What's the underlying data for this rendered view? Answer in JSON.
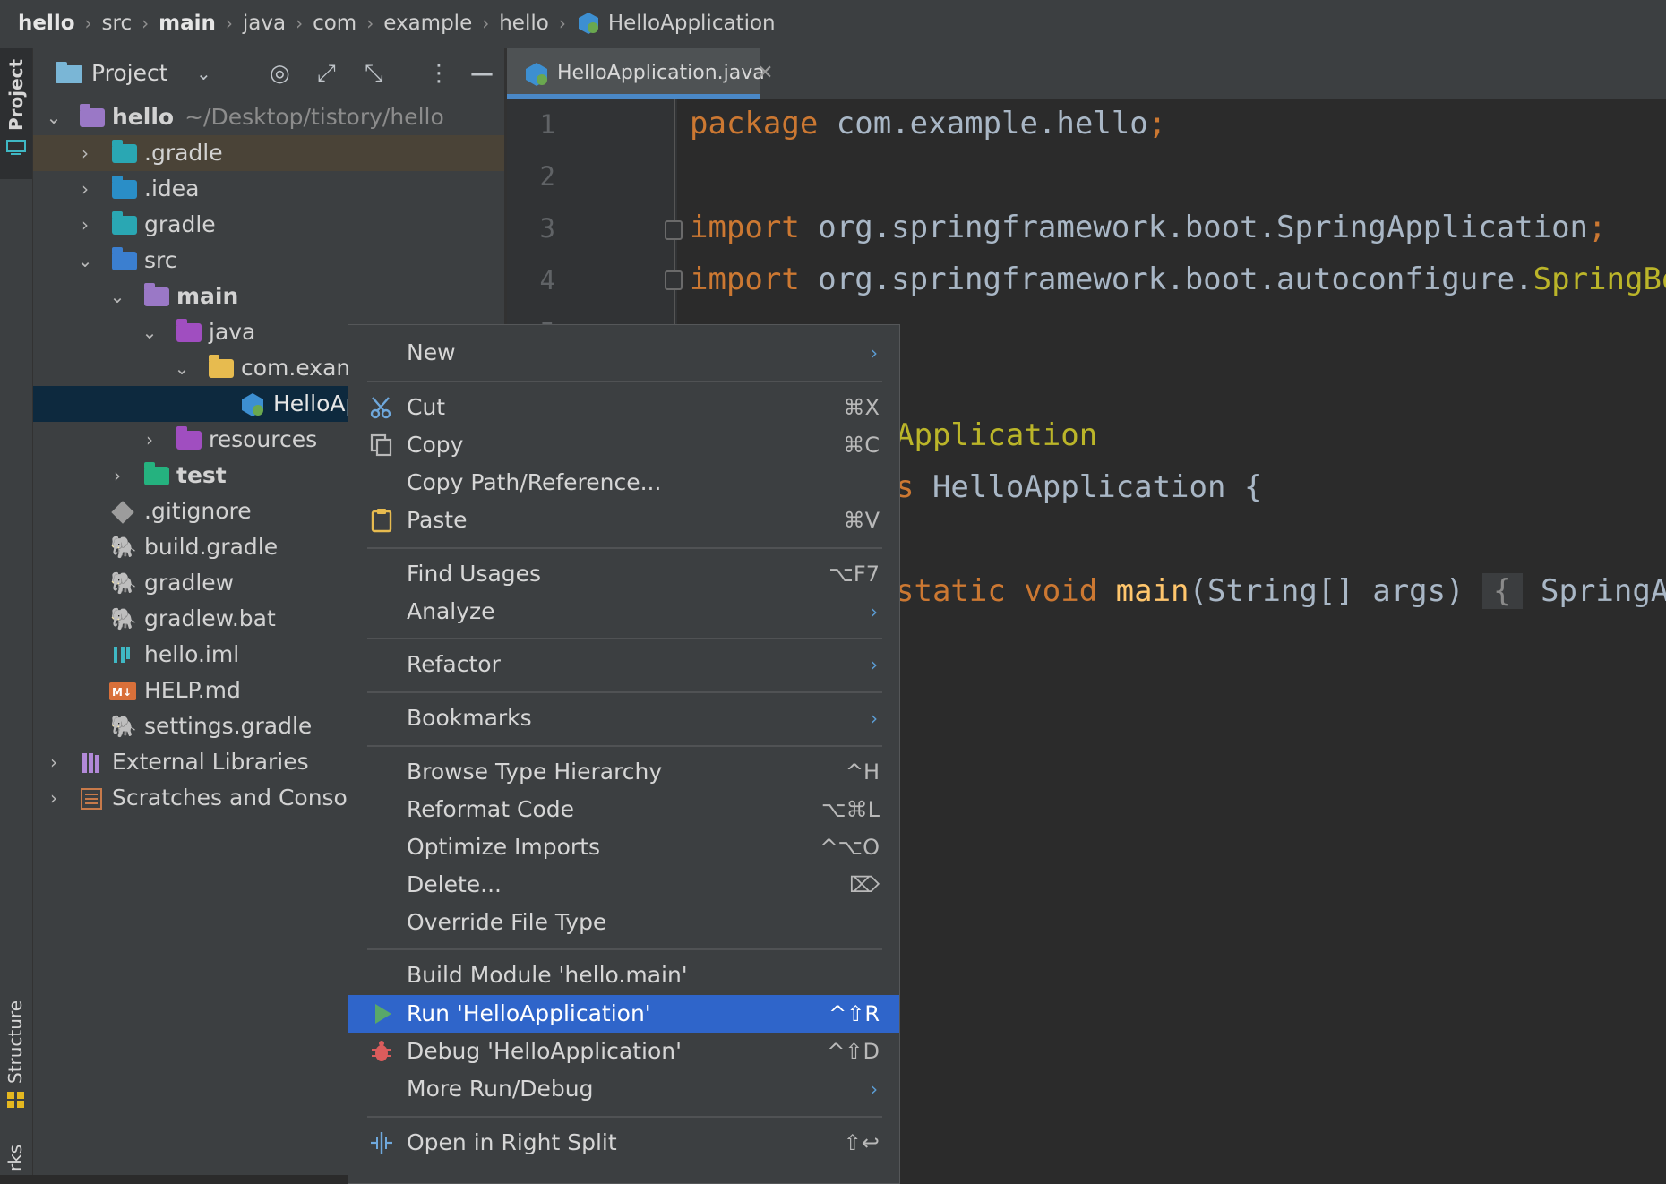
{
  "breadcrumb": [
    "hello",
    "src",
    "main",
    "java",
    "com",
    "example",
    "hello",
    "HelloApplication"
  ],
  "stripe": {
    "project_label": "Project",
    "structure_label": "Structure",
    "bookmarks_label": "rks"
  },
  "panel": {
    "title": "Project"
  },
  "tree": [
    {
      "label": "hello",
      "path": "~/Desktop/tistory/hello"
    },
    {
      "label": ".gradle"
    },
    {
      "label": ".idea"
    },
    {
      "label": "gradle"
    },
    {
      "label": "src"
    },
    {
      "label": "main"
    },
    {
      "label": "java"
    },
    {
      "label": "com.exam"
    },
    {
      "label": "HelloAp"
    },
    {
      "label": "resources"
    },
    {
      "label": "test"
    },
    {
      "label": ".gitignore"
    },
    {
      "label": "build.gradle"
    },
    {
      "label": "gradlew"
    },
    {
      "label": "gradlew.bat"
    },
    {
      "label": "hello.iml"
    },
    {
      "label": "HELP.md"
    },
    {
      "label": "settings.gradle"
    },
    {
      "label": "External Libraries"
    },
    {
      "label": "Scratches and Conso"
    }
  ],
  "editor": {
    "tab_label": "HelloApplication.java",
    "line_numbers": [
      "1",
      "2",
      "3",
      "4",
      "5"
    ],
    "code": {
      "l1_kw": "package",
      "l1_rest": " com.example.hello",
      "l1_semi": ";",
      "l3_kw": "import",
      "l3_rest": " org.springframework.boot.SpringApplication",
      "l3_semi": ";",
      "l4_kw": "import",
      "l4_rest": " org.springframework.boot.autoconfigure.",
      "l4_ann": "SpringBo",
      "l7_ann": "Application",
      "l8_kw": "s",
      "l8_rest": " HelloApplication {",
      "l10_kw": "static void ",
      "l10_fn": "main",
      "l10_rest": "(String[] args) ",
      "l10_brace": "{",
      "l10_tail": " SpringApp"
    }
  },
  "context_menu": {
    "items": [
      {
        "label": "New",
        "shortcut": "",
        "submenu": "›"
      },
      {
        "label": "Cut",
        "shortcut": "⌘X"
      },
      {
        "label": "Copy",
        "shortcut": "⌘C"
      },
      {
        "label": "Copy Path/Reference...",
        "shortcut": ""
      },
      {
        "label": "Paste",
        "shortcut": "⌘V"
      },
      {
        "label": "Find Usages",
        "shortcut": "⌥F7"
      },
      {
        "label": "Analyze",
        "shortcut": "",
        "submenu": "›"
      },
      {
        "label": "Refactor",
        "shortcut": "",
        "submenu": "›"
      },
      {
        "label": "Bookmarks",
        "shortcut": "",
        "submenu": "›"
      },
      {
        "label": "Browse Type Hierarchy",
        "shortcut": "^H"
      },
      {
        "label": "Reformat Code",
        "shortcut": "⌥⌘L"
      },
      {
        "label": "Optimize Imports",
        "shortcut": "^⌥O"
      },
      {
        "label": "Delete...",
        "shortcut": "⌦"
      },
      {
        "label": "Override File Type",
        "shortcut": ""
      },
      {
        "label": "Build Module 'hello.main'",
        "shortcut": ""
      },
      {
        "label": "Run 'HelloApplication'",
        "shortcut": "^⇧R"
      },
      {
        "label": "Debug 'HelloApplication'",
        "shortcut": "^⇧D"
      },
      {
        "label": "More Run/Debug",
        "shortcut": "",
        "submenu": "›"
      },
      {
        "label": "Open in Right Split",
        "shortcut": "⇧↩"
      }
    ]
  },
  "colors": {
    "selection": "#2f65ca",
    "keyword": "#cc7832",
    "annotation": "#bbb529",
    "function": "#ffc66d"
  }
}
